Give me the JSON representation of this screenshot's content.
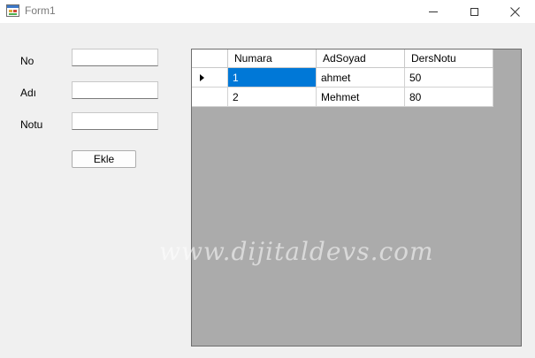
{
  "window": {
    "title": "Form1"
  },
  "form": {
    "fields": [
      {
        "label": "No",
        "value": ""
      },
      {
        "label": "Adı",
        "value": ""
      },
      {
        "label": "Notu",
        "value": ""
      }
    ],
    "add_button_label": "Ekle"
  },
  "grid": {
    "columns": [
      "Numara",
      "AdSoyad",
      "DersNotu"
    ],
    "rows": [
      [
        "1",
        "ahmet",
        "50"
      ],
      [
        "2",
        "Mehmet",
        "80"
      ]
    ],
    "selection_color": "#0078d7"
  },
  "watermark": "www.dijitaldevs.com"
}
